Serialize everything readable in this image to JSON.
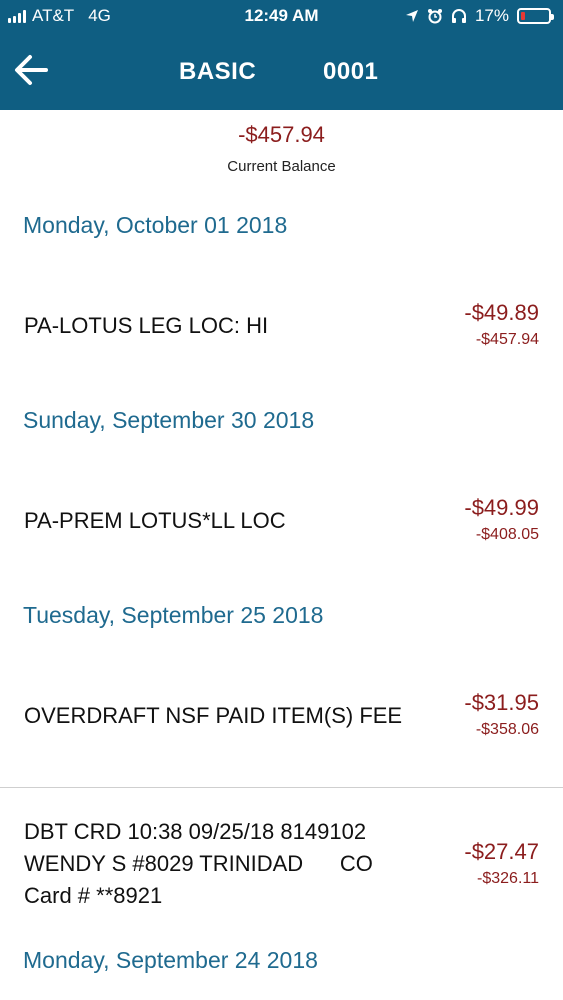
{
  "status_bar": {
    "carrier": "AT&T",
    "network": "4G",
    "time": "12:49 AM",
    "battery_percent": "17%",
    "battery_level": 0.17,
    "icons": [
      "location-arrow-icon",
      "alarm-clock-icon",
      "headphones-icon",
      "battery-icon"
    ]
  },
  "header": {
    "account_type": "BASIC",
    "account_number": "0001",
    "back_icon": "arrow-left-icon"
  },
  "balance": {
    "amount": "-$457.94",
    "label": "Current Balance"
  },
  "groups": [
    {
      "date": "Monday, October 01 2018",
      "transactions": [
        {
          "description": "PA-LOTUS LEG LOC: HI",
          "amount": "-$49.89",
          "running_balance": "-$457.94"
        }
      ]
    },
    {
      "date": "Sunday, September 30 2018",
      "transactions": [
        {
          "description": "PA-PREM LOTUS*LL LOC",
          "amount": "-$49.99",
          "running_balance": "-$408.05"
        }
      ]
    },
    {
      "date": "Tuesday, September 25 2018",
      "transactions": [
        {
          "description": "OVERDRAFT NSF PAID ITEM(S) FEE",
          "amount": "-$31.95",
          "running_balance": "-$358.06"
        },
        {
          "description_lines": [
            "DBT CRD 10:38 09/25/18 8149102",
            "WENDY S #8029 TRINIDAD      CO",
            "Card # **8921"
          ],
          "amount": "-$27.47",
          "running_balance": "-$326.11"
        }
      ]
    },
    {
      "date": "Monday, September 24 2018",
      "transactions": []
    }
  ],
  "colors": {
    "header_bg": "#0f5e82",
    "date_text": "#1f6a8f",
    "negative_amount": "#8b1d1d"
  }
}
